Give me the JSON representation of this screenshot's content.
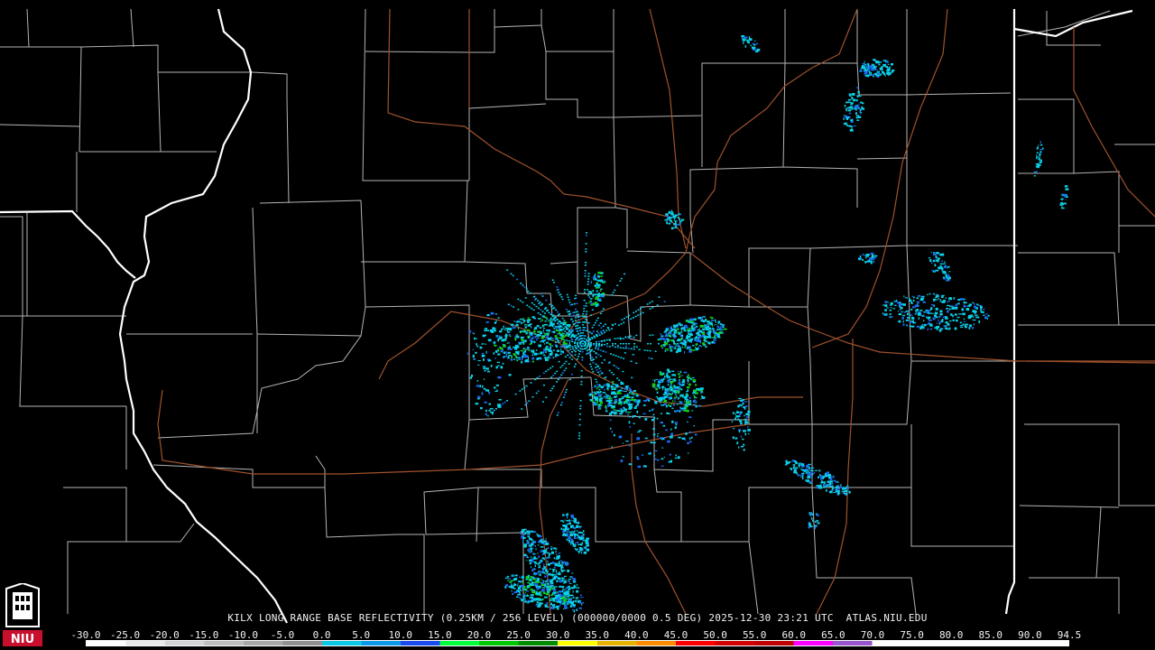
{
  "product": {
    "title": "KILX LONG RANGE BASE REFLECTIVITY (0.25KM / 256 LEVEL) (000000/0000 0.5 DEG) 2025-12-30 23:21 UTC  ATLAS.NIU.EDU"
  },
  "scale": {
    "labels": [
      "-30.0",
      "-25.0",
      "-20.0",
      "-15.0",
      "-10.0",
      "-5.0",
      "0.0",
      "5.0",
      "10.0",
      "15.0",
      "20.0",
      "25.0",
      "30.0",
      "35.0",
      "40.0",
      "45.0",
      "50.0",
      "55.0",
      "60.0",
      "65.0",
      "70.0",
      "75.0",
      "80.0",
      "85.0",
      "90.0",
      "94.5"
    ],
    "colors": [
      "#ffffff",
      "#e9e9e9",
      "#d3d3d3",
      "#bdbdbd",
      "#a7a7a7",
      "#919191",
      "#0cc9e6",
      "#0a9ae8",
      "#1a4bf0",
      "#00ff3c",
      "#00c800",
      "#008c00",
      "#ffff00",
      "#e6b400",
      "#ff8c00",
      "#ff0000",
      "#d40000",
      "#c00000",
      "#ff00ff",
      "#9955cc",
      "#ffffff",
      "#ffffff",
      "#ffffff",
      "#ffffff",
      "#ffffff"
    ]
  },
  "logo": {
    "text": "NIU",
    "colors": {
      "red": "#c8102e",
      "white": "#ffffff"
    }
  },
  "map_colors": {
    "background": "#000000",
    "state_border": "#ffffff",
    "county_border": "#b4b4b4",
    "highway": "#a0522d",
    "echo_light": "#0bd0e8",
    "echo_mid": "#1a6cf0",
    "echo_strong": "#11d011"
  }
}
